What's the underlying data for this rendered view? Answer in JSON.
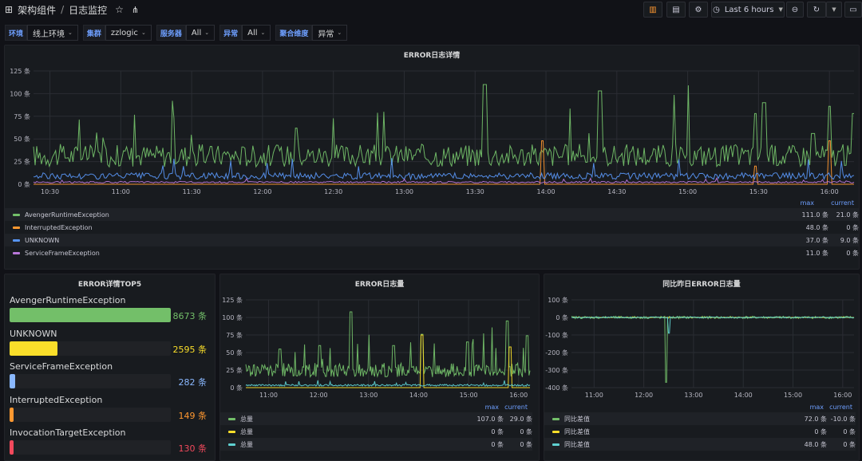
{
  "nav": {
    "grid_icon": "apps-icon",
    "folder": "架构组件",
    "separator": "/",
    "dashboard": "日志监控",
    "time_range": "Last 6 hours"
  },
  "variables": [
    {
      "label": "环境",
      "value": "线上环境"
    },
    {
      "label": "集群",
      "value": "zzlogic"
    },
    {
      "label": "服务器",
      "value": "All"
    },
    {
      "label": "异常",
      "value": "All"
    },
    {
      "label": "聚合维度",
      "value": "异常"
    }
  ],
  "colors": {
    "green": "#73bf69",
    "orange": "#ff9830",
    "blue": "#5794f2",
    "purple": "#b877d9",
    "magenta": "#c4379a",
    "yellow": "#fade2a",
    "red": "#f2495c",
    "lightblue": "#8ab8ff",
    "cyan": "#5fd1d1"
  },
  "panel_main": {
    "title": "ERROR日志详情",
    "legend_headers": [
      "max",
      "current"
    ],
    "legend": [
      {
        "name": "AvengerRuntimeException",
        "max": "111.0 条",
        "current": "21.0 条",
        "color": "#73bf69"
      },
      {
        "name": "InterruptedException",
        "max": "48.0 条",
        "current": "0 条",
        "color": "#ff9830"
      },
      {
        "name": "UNKNOWN",
        "max": "37.0 条",
        "current": "9.0 条",
        "color": "#5794f2"
      },
      {
        "name": "ServiceFrameException",
        "max": "11.0 条",
        "current": "0 条",
        "color": "#b877d9"
      }
    ]
  },
  "panel_top5": {
    "title": "ERROR详情TOP5",
    "items": [
      {
        "name": "AvengerRuntimeException",
        "value": "8673 条",
        "fraction": 1.0,
        "color": "#73bf69"
      },
      {
        "name": "UNKNOWN",
        "value": "2595 条",
        "fraction": 0.299,
        "color": "#fade2a"
      },
      {
        "name": "ServiceFrameException",
        "value": "282 条",
        "fraction": 0.033,
        "color": "#8ab8ff"
      },
      {
        "name": "InterruptedException",
        "value": "149 条",
        "fraction": 0.017,
        "color": "#ff9830"
      },
      {
        "name": "InvocationTargetException",
        "value": "130 条",
        "fraction": 0.015,
        "color": "#f2495c"
      }
    ]
  },
  "panel_volume": {
    "title": "ERROR日志量",
    "legend_headers": [
      "max",
      "current"
    ],
    "legend": [
      {
        "name": "总量",
        "max": "107.0 条",
        "current": "29.0 条",
        "color": "#73bf69"
      },
      {
        "name": "总量",
        "max": "0 条",
        "current": "0 条",
        "color": "#fade2a"
      },
      {
        "name": "总量",
        "max": "0 条",
        "current": "0 条",
        "color": "#5fd1d1"
      }
    ]
  },
  "panel_compare": {
    "title": "同比昨日ERROR日志量",
    "legend_headers": [
      "max",
      "current"
    ],
    "legend": [
      {
        "name": "同比差值",
        "max": "72.0 条",
        "current": "-10.0 条",
        "color": "#73bf69"
      },
      {
        "name": "同比差值",
        "max": "0 条",
        "current": "0 条",
        "color": "#fade2a"
      },
      {
        "name": "同比差值",
        "max": "48.0 条",
        "current": "0 条",
        "color": "#5fd1d1"
      }
    ]
  },
  "chart_data": [
    {
      "type": "line",
      "title": "ERROR日志详情",
      "x": [
        "10:30",
        "11:00",
        "11:30",
        "12:00",
        "12:30",
        "13:00",
        "13:30",
        "14:00",
        "14:30",
        "15:00",
        "15:30",
        "16:00"
      ],
      "y_ticks": [
        "0 条",
        "25 条",
        "50 条",
        "75 条",
        "100 条",
        "125 条"
      ],
      "ylim": [
        0,
        125
      ],
      "series": [
        {
          "name": "AvengerRuntimeException",
          "baseline": 28,
          "spikes": [
            [
              0.32,
              62
            ],
            [
              0.55,
              110
            ],
            [
              0.69,
              103
            ],
            [
              0.88,
              78
            ],
            [
              0.89,
              90
            ],
            [
              0.95,
              56
            ],
            [
              0.97,
              86
            ],
            [
              1.0,
              78
            ]
          ],
          "color": "#73bf69"
        },
        {
          "name": "InterruptedException",
          "baseline": 0,
          "spikes": [
            [
              0.62,
              48
            ],
            [
              0.88,
              20
            ],
            [
              0.97,
              48
            ]
          ],
          "color": "#ff9830"
        },
        {
          "name": "UNKNOWN",
          "baseline": 8,
          "spikes": [],
          "color": "#5794f2"
        },
        {
          "name": "ServiceFrameException",
          "baseline": 2,
          "spikes": [],
          "color": "#b877d9"
        }
      ]
    },
    {
      "type": "line",
      "title": "ERROR日志量",
      "x": [
        "11:00",
        "12:00",
        "13:00",
        "14:00",
        "15:00",
        "16:00"
      ],
      "y_ticks": [
        "0 条",
        "25 条",
        "50 条",
        "75 条",
        "100 条",
        "125 条"
      ],
      "ylim": [
        0,
        125
      ],
      "series": [
        {
          "name": "总量",
          "baseline": 22,
          "color": "#73bf69"
        },
        {
          "name": "总量",
          "baseline": 0,
          "color": "#fade2a"
        },
        {
          "name": "总量",
          "baseline": 3,
          "color": "#5fd1d1"
        }
      ]
    },
    {
      "type": "line",
      "title": "同比昨日ERROR日志量",
      "x": [
        "11:00",
        "12:00",
        "13:00",
        "14:00",
        "15:00",
        "16:00"
      ],
      "y_ticks": [
        "100 条",
        "0 条",
        "-100 条",
        "-200 条",
        "-300 条",
        "-400 条"
      ],
      "ylim": [
        -400,
        100
      ],
      "series": [
        {
          "name": "同比差值",
          "baseline": 0,
          "color": "#73bf69"
        },
        {
          "name": "同比差值",
          "baseline": 0,
          "color": "#fade2a"
        },
        {
          "name": "同比差值",
          "baseline": 0,
          "color": "#5fd1d1"
        }
      ]
    }
  ]
}
